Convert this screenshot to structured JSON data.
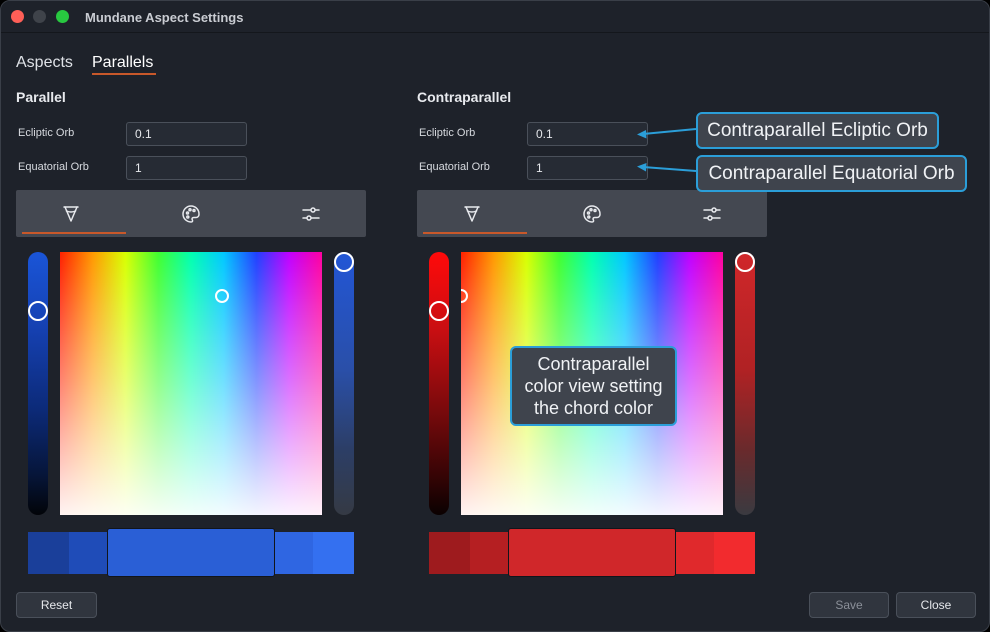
{
  "window": {
    "title": "Mundane Aspect Settings"
  },
  "tabs": [
    {
      "label": "Aspects"
    },
    {
      "label": "Parallels"
    }
  ],
  "parallel": {
    "title": "Parallel",
    "ecliptic_label": "Ecliptic Orb",
    "ecliptic_value": "0.1",
    "equatorial_label": "Equatorial Orb",
    "equatorial_value": "1",
    "tools": [
      "eyedropper-icon",
      "palette-icon",
      "sliders-icon"
    ],
    "accent_color": "#2a5fd6"
  },
  "contraparallel": {
    "title": "Contraparallel",
    "ecliptic_label": "Ecliptic Orb",
    "ecliptic_value": "0.1",
    "equatorial_label": "Equatorial Orb",
    "equatorial_value": "1",
    "tools": [
      "eyedropper-icon",
      "palette-icon",
      "sliders-icon"
    ],
    "accent_color": "#d0272a"
  },
  "callouts": {
    "ecliptic": "Contraparallel Ecliptic Orb",
    "equatorial": "Contraparallel Equatorial Orb",
    "color_line1": "Contraparallel",
    "color_line2": "color view setting",
    "color_line3": "the chord color"
  },
  "buttons": {
    "reset": "Reset",
    "save": "Save",
    "close": "Close"
  },
  "colors": {
    "tab_accent": "#c8582a",
    "callout_border": "#2b9ed8",
    "window_bg": "#1e222a"
  }
}
